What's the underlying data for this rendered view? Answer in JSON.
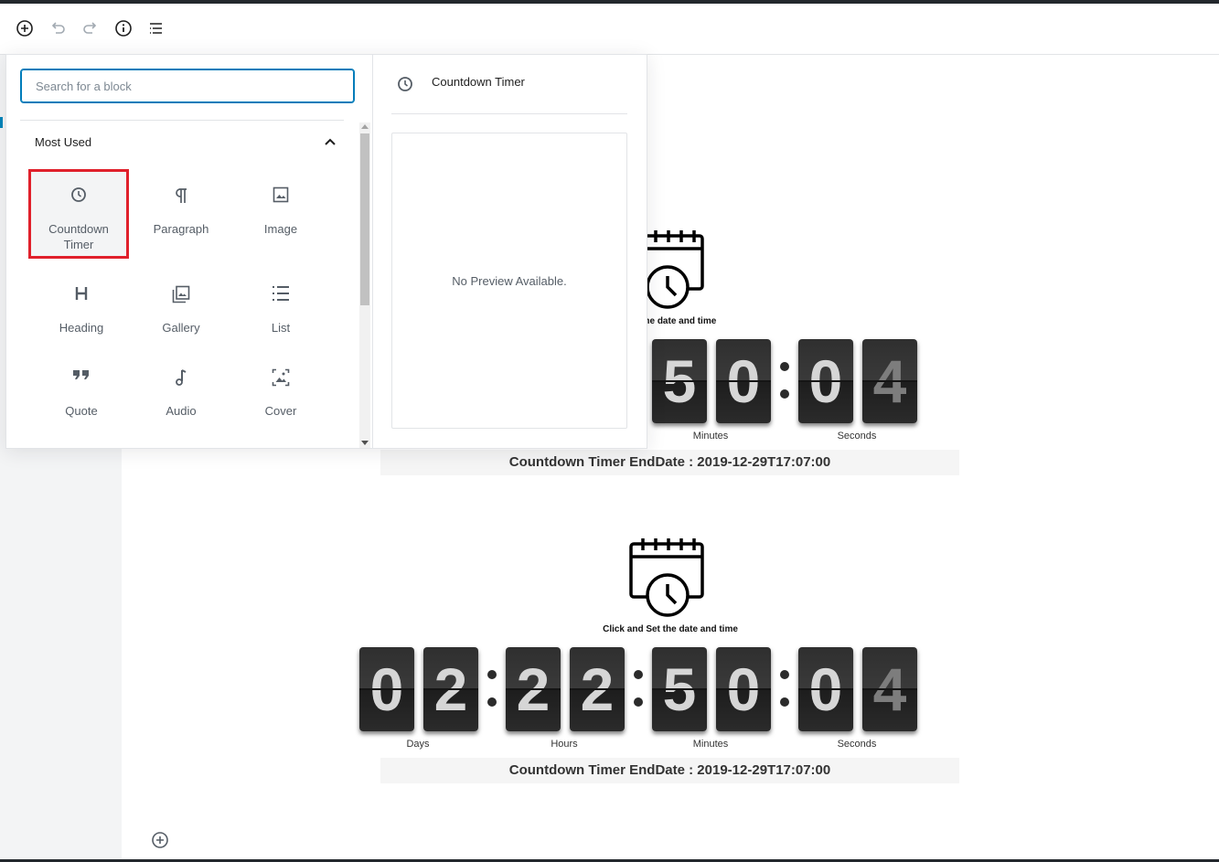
{
  "toolbar": {
    "add_icon": "plus-circle-icon",
    "undo_icon": "undo-icon",
    "redo_icon": "redo-icon",
    "info_icon": "info-icon",
    "outline_icon": "list-outline-icon"
  },
  "inserter": {
    "search_placeholder": "Search for a block",
    "panel_title": "Most Used",
    "blocks": [
      {
        "label": "Countdown Timer",
        "icon": "clock-icon"
      },
      {
        "label": "Paragraph",
        "icon": "pilcrow-icon"
      },
      {
        "label": "Image",
        "icon": "image-icon"
      },
      {
        "label": "Heading",
        "icon": "heading-icon"
      },
      {
        "label": "Gallery",
        "icon": "gallery-icon"
      },
      {
        "label": "List",
        "icon": "list-icon"
      },
      {
        "label": "Quote",
        "icon": "quote-icon"
      },
      {
        "label": "Audio",
        "icon": "audio-icon"
      },
      {
        "label": "Cover",
        "icon": "cover-icon"
      }
    ],
    "preview_title": "Countdown Timer",
    "preview_empty": "No Preview Available."
  },
  "timers": [
    {
      "caption": "Set the date and time",
      "digits": [
        "5",
        "0",
        "0",
        "4"
      ],
      "units": [
        "Minutes",
        "Seconds"
      ],
      "enddate": "Countdown Timer EndDate : 2019-12-29T17:07:00"
    },
    {
      "caption": "Click and Set the date and time",
      "digits": [
        "0",
        "2",
        "2",
        "2",
        "5",
        "0",
        "0",
        "4"
      ],
      "units": [
        "Days",
        "Hours",
        "Minutes",
        "Seconds"
      ],
      "enddate": "Countdown Timer EndDate : 2019-12-29T17:07:00"
    }
  ],
  "colors": {
    "accent": "#007cba",
    "highlight": "#e0202b",
    "card": "#2f2f2f"
  }
}
